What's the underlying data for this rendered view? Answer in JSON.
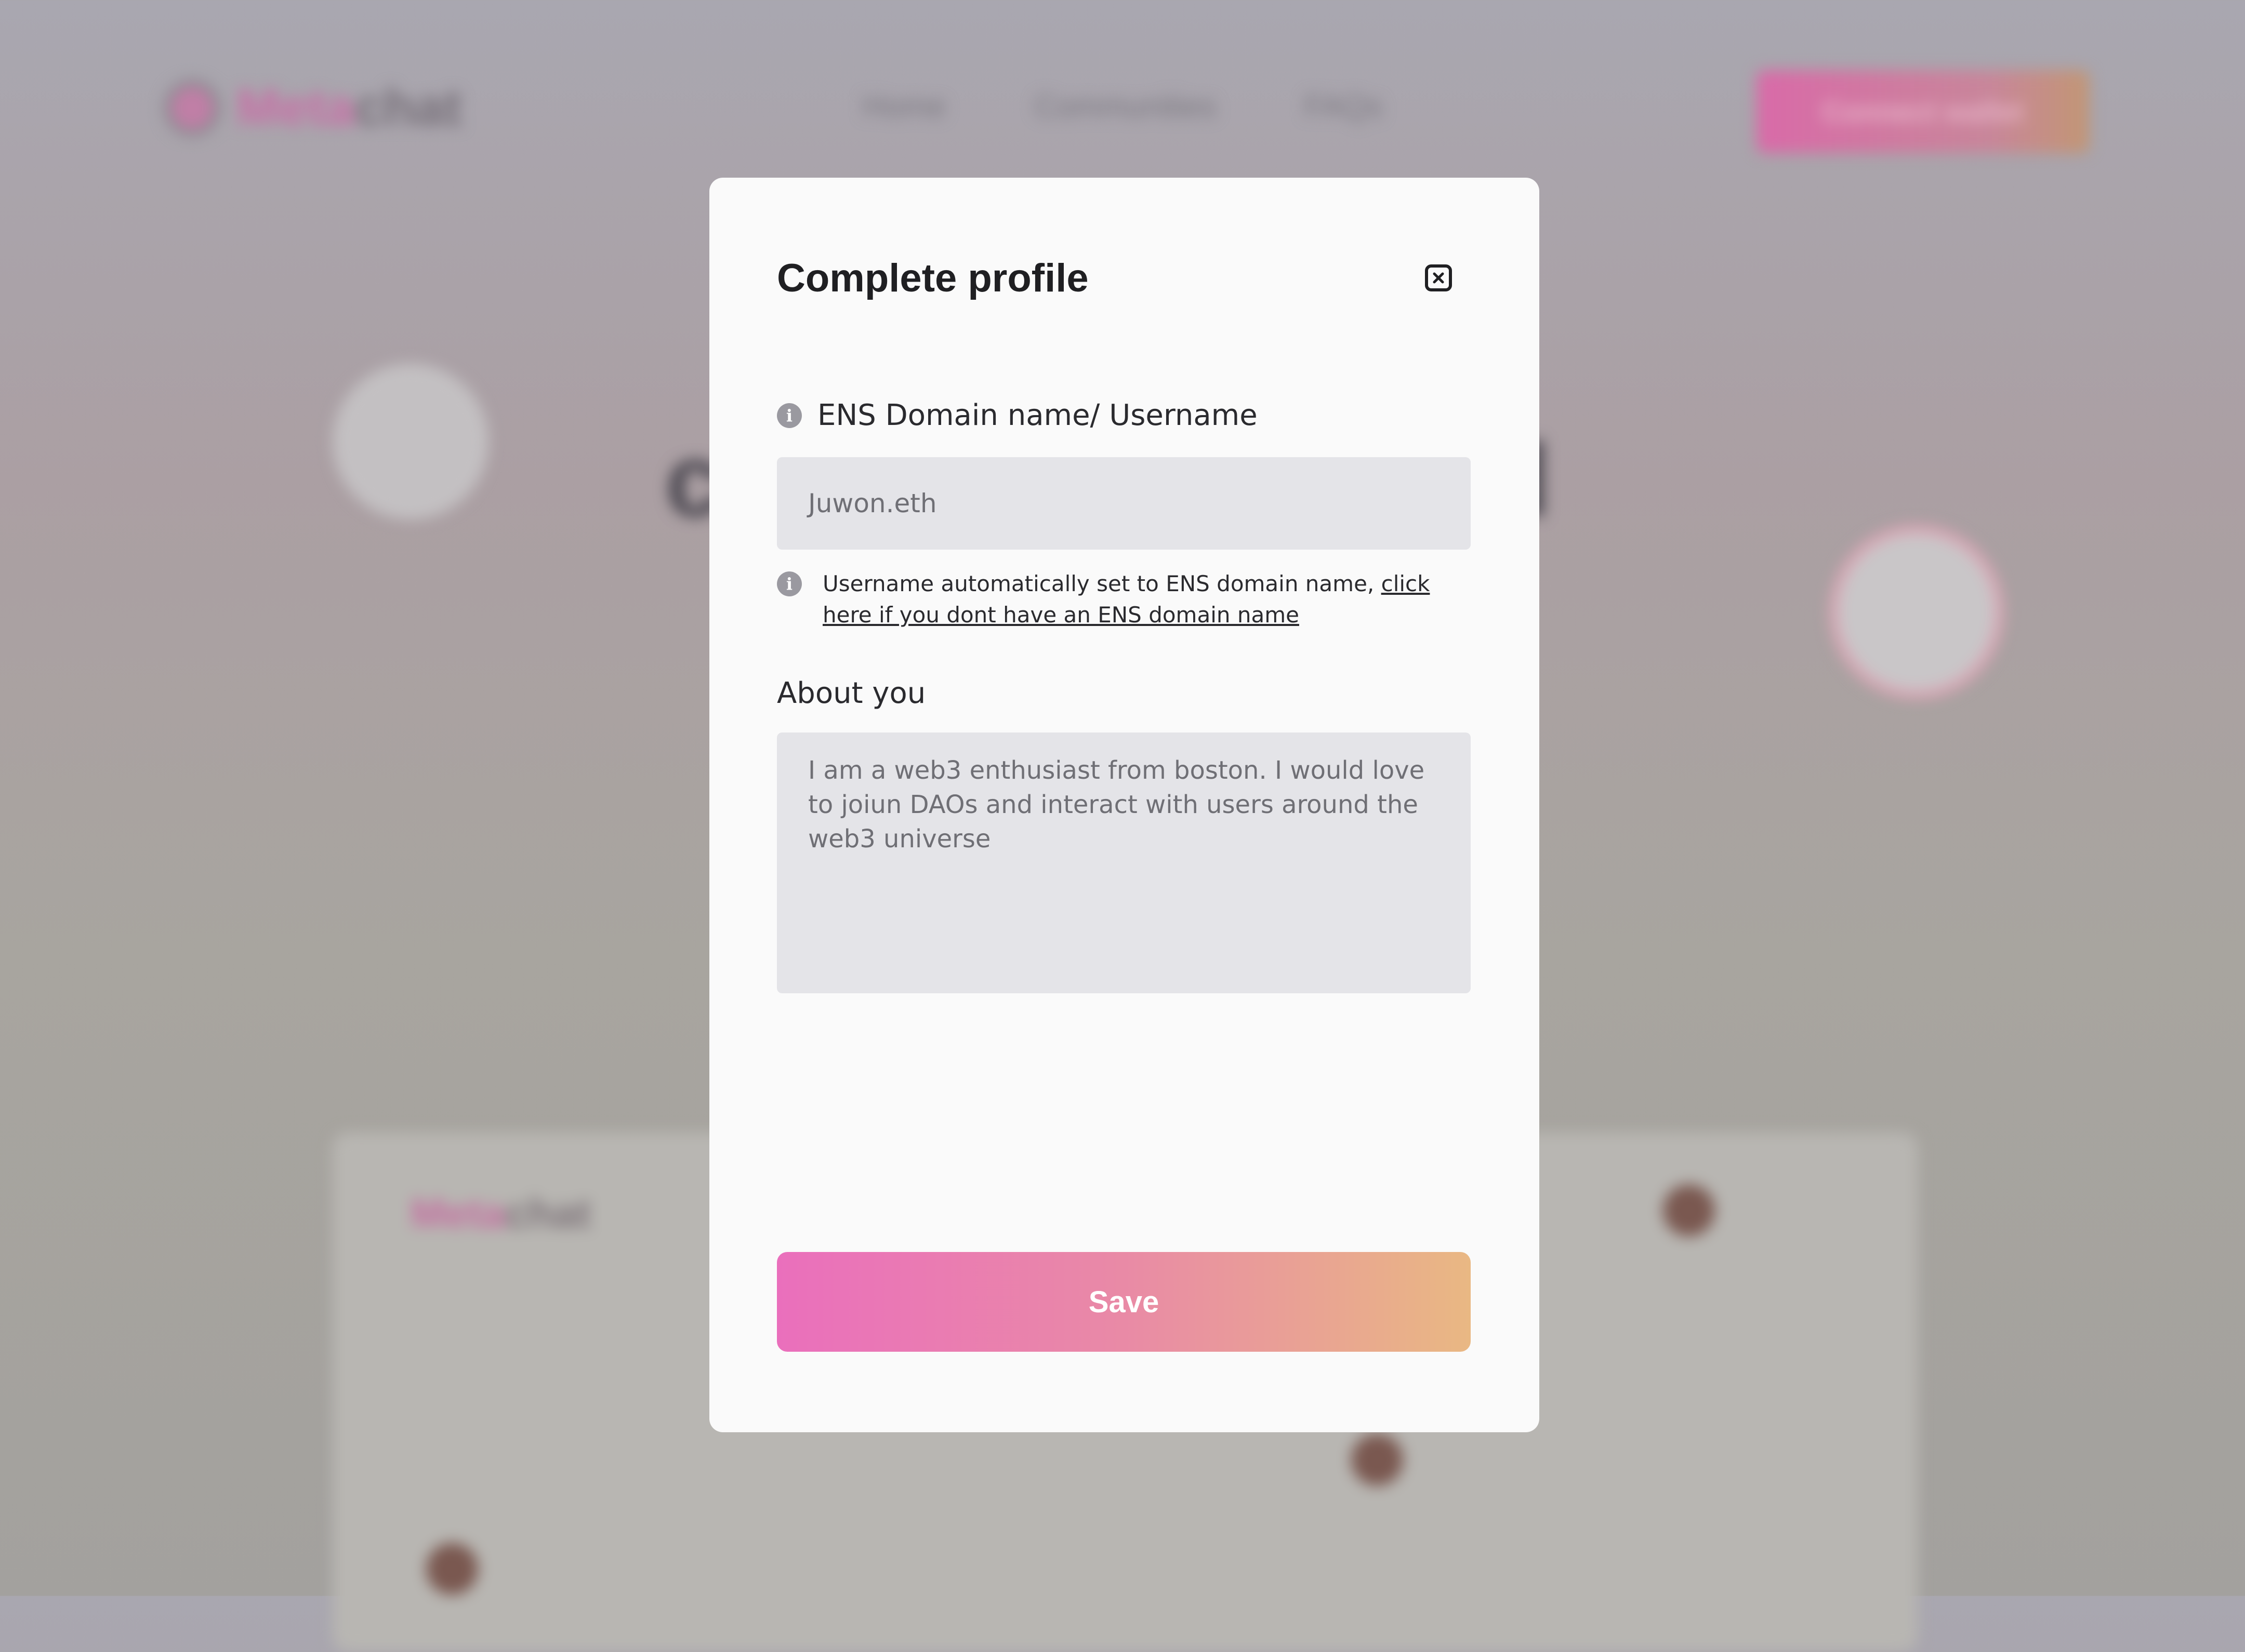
{
  "background": {
    "logo_prefix": "Meta",
    "logo_suffix": "chat",
    "nav_links": [
      "Home",
      "Communities",
      "FAQs"
    ],
    "connect_label": "Connect wallet",
    "preview_logo_prefix": "Meta",
    "preview_logo_suffix": "chat"
  },
  "modal": {
    "title": "Complete profile",
    "close_icon": "close-icon",
    "ens_label": "ENS Domain name/ Username",
    "ens_value": "Juwon.eth",
    "hint_text": "Username automatically set to ENS domain name, ",
    "hint_link": "click here if you dont have an ENS domain name",
    "about_label": "About you",
    "about_value": "I am a web3  enthusiast from boston. I would love to joiun DAOs and interact with users around the web3 universe",
    "save_label": "Save"
  },
  "colors": {
    "accent_start": "#ea6fbc",
    "accent_end": "#e9b883",
    "field_bg": "#e4e4e8"
  }
}
